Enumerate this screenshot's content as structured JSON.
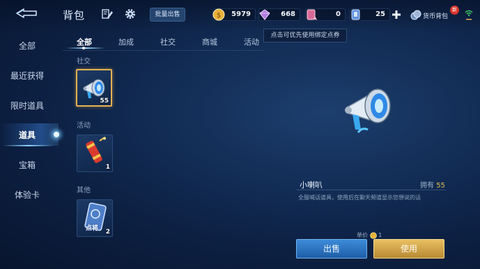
{
  "header": {
    "title": "背包",
    "bulk_sell_label": "批量出售",
    "wallet_label": "货币背包",
    "new_badge": "新"
  },
  "currencies": [
    {
      "name": "gold-coin",
      "value": "5979",
      "color": "#e8b13a"
    },
    {
      "name": "diamond",
      "value": "668",
      "color": "#b07ae0"
    },
    {
      "name": "ticket-pink",
      "value": "0",
      "color": "#d86a9a"
    },
    {
      "name": "voucher-blue",
      "value": "25",
      "color": "#5c8fe0"
    }
  ],
  "sidebar": {
    "items": [
      {
        "label": "全部"
      },
      {
        "label": "最近获得"
      },
      {
        "label": "限时道具"
      },
      {
        "label": "道具"
      },
      {
        "label": "宝箱"
      },
      {
        "label": "体验卡"
      }
    ],
    "active_index": 3
  },
  "tabs": {
    "items": [
      {
        "label": "全部"
      },
      {
        "label": "加成"
      },
      {
        "label": "社交"
      },
      {
        "label": "商城"
      },
      {
        "label": "活动"
      }
    ],
    "active_index": 0
  },
  "tooltip": "点击可优先使用绑定点券",
  "sections": [
    {
      "label": "社交",
      "items": [
        {
          "icon": "megaphone-icon",
          "count": "55",
          "selected": true
        }
      ]
    },
    {
      "label": "活动",
      "items": [
        {
          "icon": "firecracker-icon",
          "count": "1"
        }
      ]
    },
    {
      "label": "其他",
      "items": [
        {
          "icon": "card-icon",
          "count": "2",
          "text": "点将"
        }
      ]
    }
  ],
  "detail": {
    "name": "小喇叭",
    "owned_label": "拥有",
    "owned_value": "55",
    "description": "全服喊话道具，使用后在聊天频道显示您想说的话",
    "unit_price_label": "单价",
    "unit_price_value": "1"
  },
  "actions": {
    "sell_label": "出售",
    "use_label": "使用"
  },
  "colors": {
    "accent_gold": "#e6b24f",
    "accent_blue": "#3c8bd8",
    "background": "#0d2144"
  }
}
